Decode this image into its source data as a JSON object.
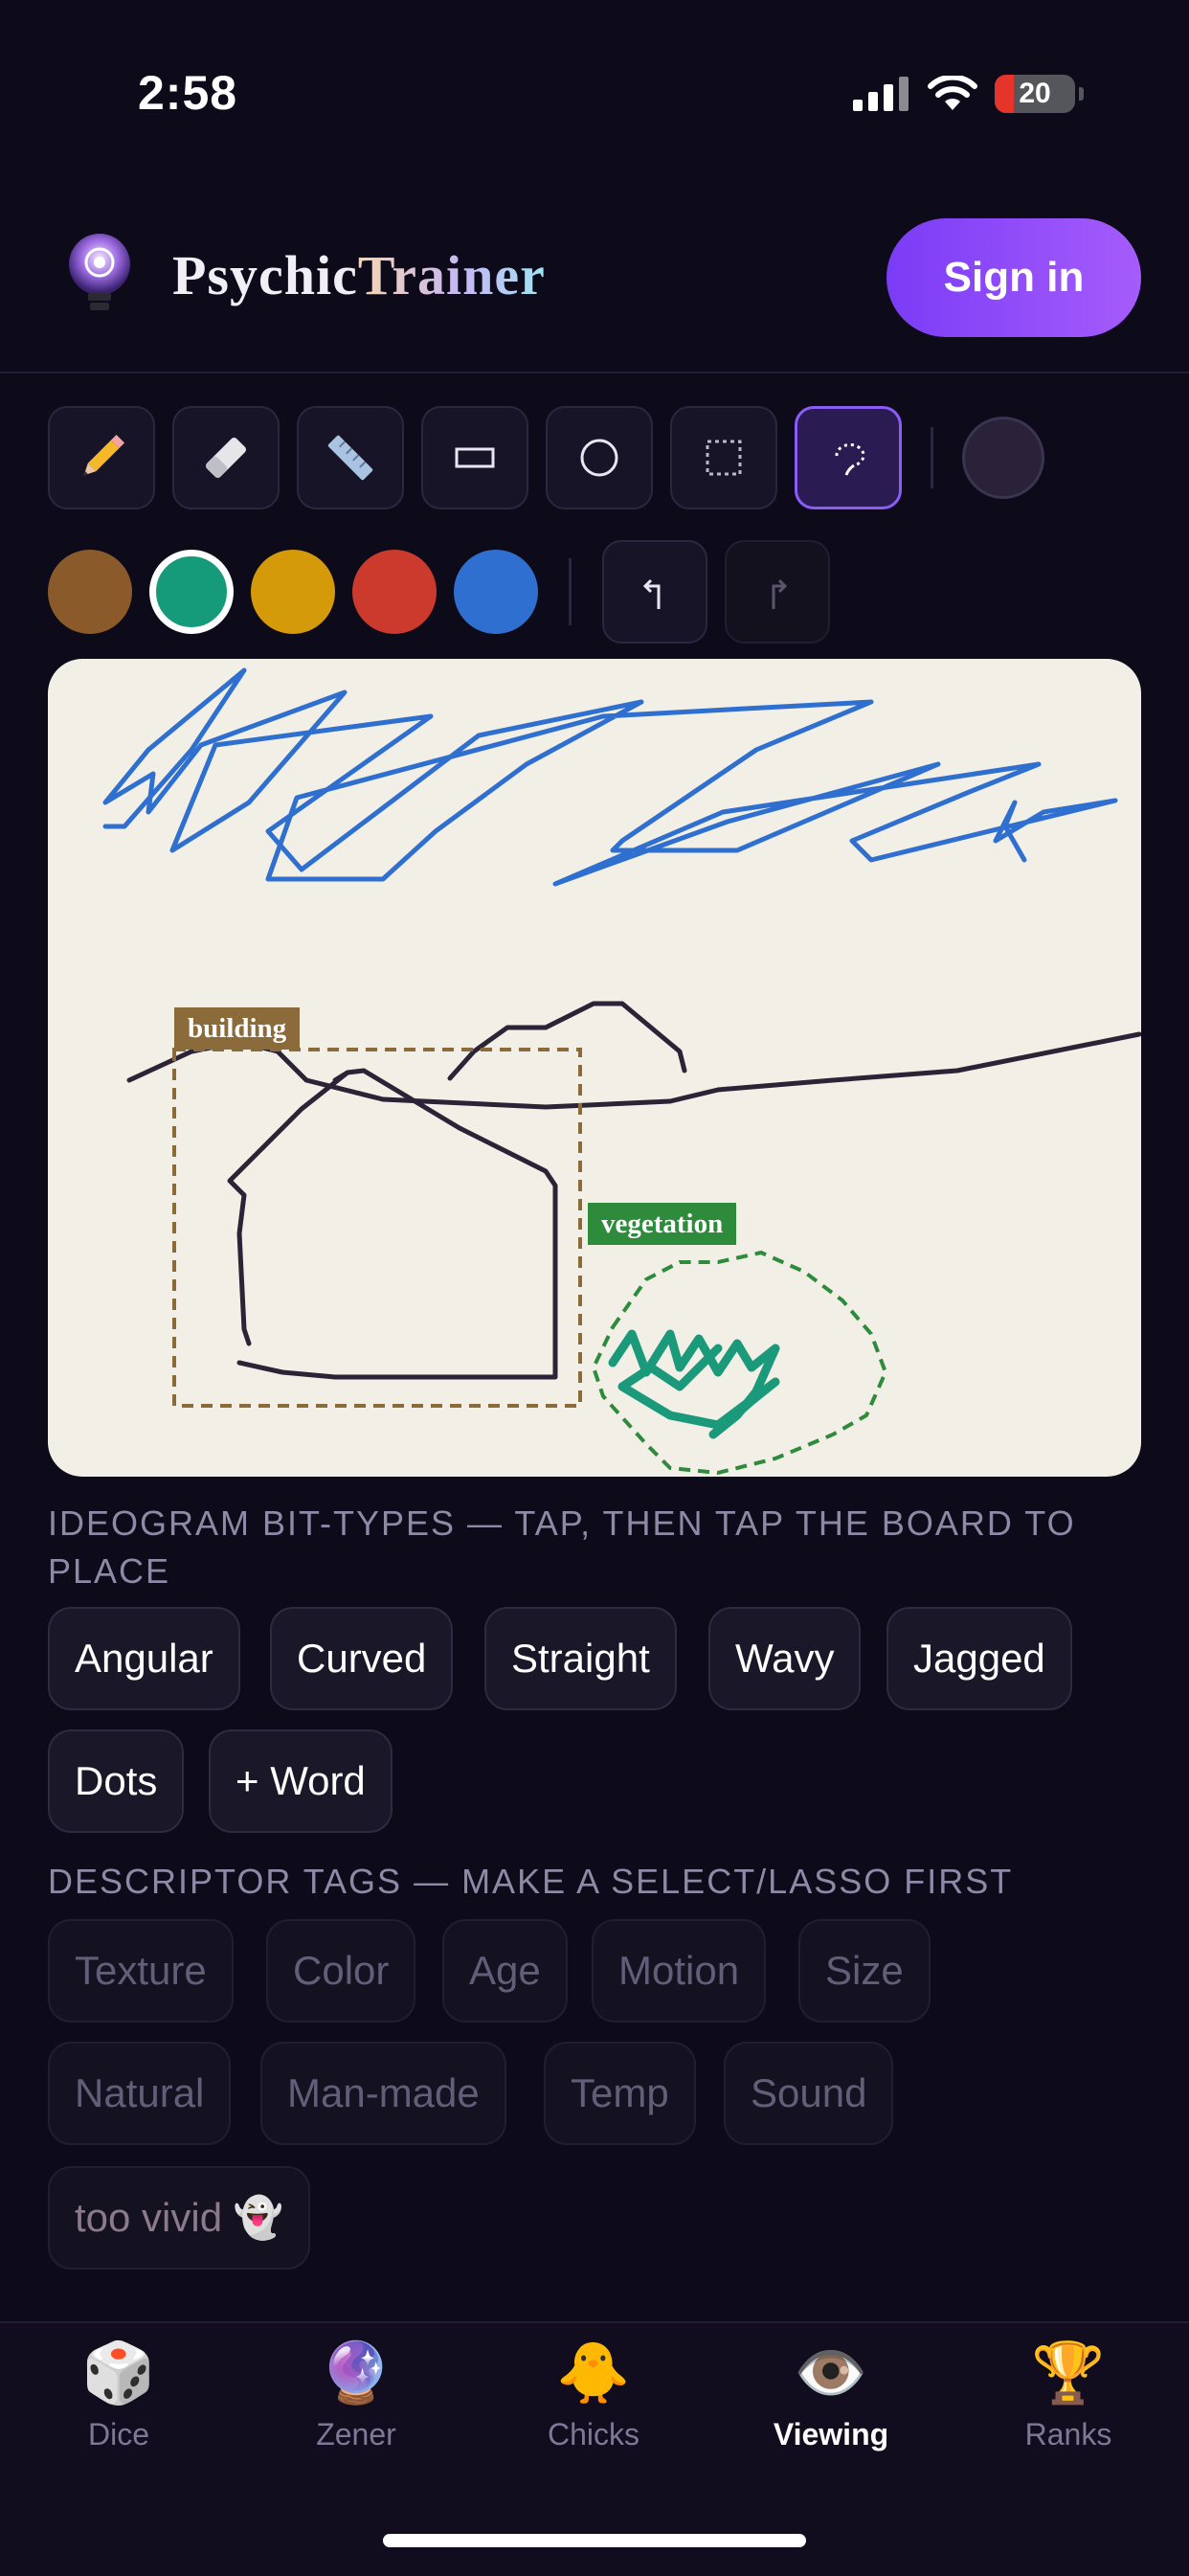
{
  "status_bar": {
    "time": "2:58",
    "battery": "20"
  },
  "header": {
    "brand_part1": "PsychicTrainer",
    "brand_a": "Psychic",
    "brand_b": "Trainer",
    "sign_in": "Sign in"
  },
  "tools": [
    "pencil-icon",
    "eraser-icon",
    "ruler-icon",
    "rectangle-icon",
    "circle-icon",
    "select-icon",
    "lasso-icon"
  ],
  "colors": {
    "swatches": [
      "#8b5a2b",
      "#159a7a",
      "#d49a0a",
      "#cc3a2e",
      "#2f6fd0"
    ],
    "selected": "#159a7a",
    "accent": "#8b5cf6"
  },
  "board": {
    "tags": [
      {
        "label": "building",
        "color": "#8b6b3a"
      },
      {
        "label": "vegetation",
        "color": "#2e8b3c"
      }
    ]
  },
  "ideogram": {
    "label": "IDEOGRAM BIT-TYPES — TAP, THEN TAP THE BOARD TO PLACE",
    "chips": [
      "Angular",
      "Curved",
      "Straight",
      "Wavy",
      "Jagged",
      "Dots",
      "+ Word"
    ]
  },
  "descriptor": {
    "label": "DESCRIPTOR TAGS — MAKE A SELECT/LASSO FIRST",
    "chips": [
      "Texture",
      "Color",
      "Age",
      "Motion",
      "Size",
      "Natural",
      "Man-made",
      "Temp",
      "Sound",
      "too vivid 👻"
    ]
  },
  "tabs": [
    {
      "icon": "🎲",
      "label": "Dice"
    },
    {
      "icon": "🔮",
      "label": "Zener"
    },
    {
      "icon": "🐥",
      "label": "Chicks"
    },
    {
      "icon": "👁️",
      "label": "Viewing"
    },
    {
      "icon": "🏆",
      "label": "Ranks"
    }
  ],
  "active_tab": "Viewing"
}
